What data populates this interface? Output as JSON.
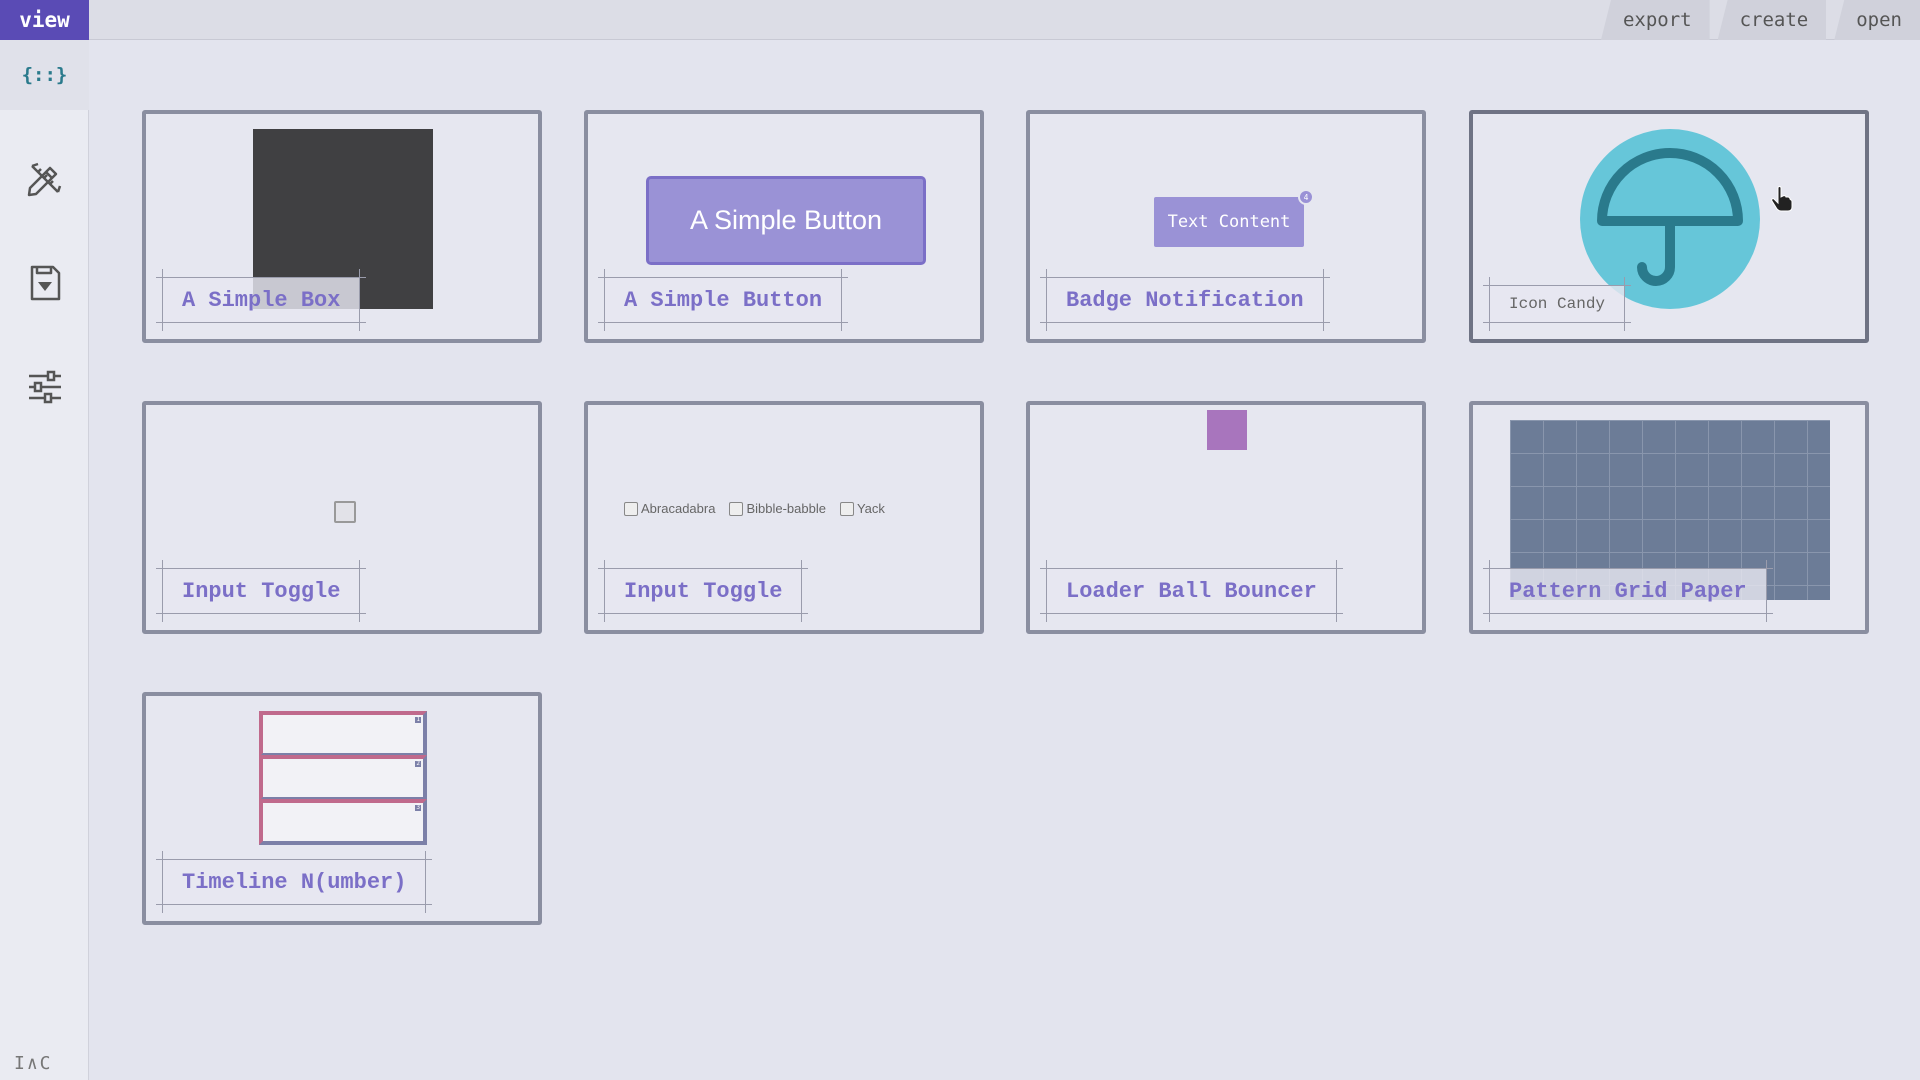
{
  "topbar": {
    "view_label": "view",
    "actions": [
      "export",
      "create",
      "open"
    ]
  },
  "sidebar": {
    "logo_text": "{::}",
    "items": [
      "edit-pencil-ruler-icon",
      "save-download-icon",
      "sliders-icon"
    ],
    "bottom_mark": "I∧C"
  },
  "cards": [
    {
      "label": "A Simple Box"
    },
    {
      "label": "A Simple Button",
      "button_text": "A Simple Button"
    },
    {
      "label": "Badge Notification",
      "button_text": "Text Content",
      "badge_count": "4"
    },
    {
      "label": "Icon Candy"
    },
    {
      "label": "Input Toggle"
    },
    {
      "label": "Input Toggle",
      "options": [
        "Abracadabra",
        "Bibble-babble",
        "Yack"
      ]
    },
    {
      "label": "Loader Ball Bouncer"
    },
    {
      "label": "Pattern Grid Paper"
    },
    {
      "label": "Timeline N(umber)"
    }
  ],
  "colors": {
    "accent": "#5a4bb5",
    "label_purple": "#7b6fc7",
    "button_purple": "#9a92d6",
    "umbrella_bg": "#66c6d9",
    "umbrella_fg": "#2a7a8c",
    "loader": "#a875bd",
    "grid": "#6c7c97"
  }
}
